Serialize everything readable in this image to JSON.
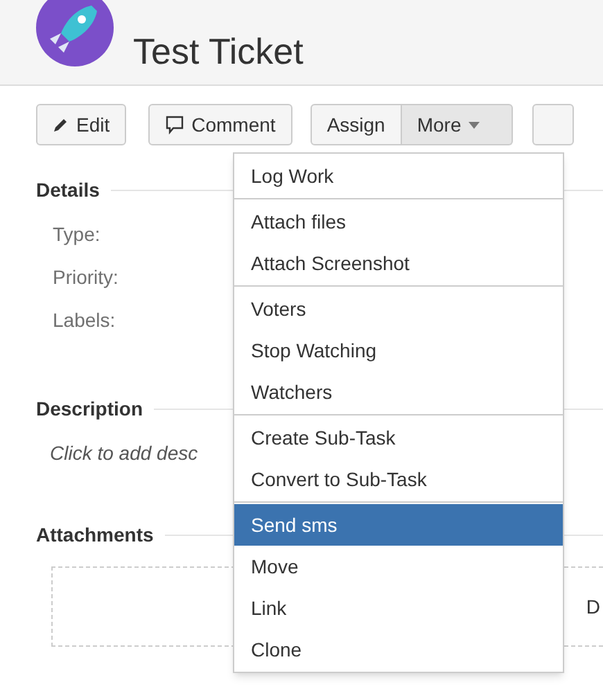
{
  "header": {
    "title": "Test Ticket"
  },
  "toolbar": [
    {
      "label": "Edit",
      "kind": "edit"
    },
    {
      "label": "Comment",
      "kind": "comment"
    },
    {
      "label": "Assign",
      "kind": "assign"
    },
    {
      "label": "More",
      "kind": "more"
    }
  ],
  "details": {
    "heading": "Details",
    "fields": [
      "Type:",
      "Priority:",
      "Labels:"
    ]
  },
  "description": {
    "heading": "Description",
    "placeholder": "Click to add desc"
  },
  "attachments": {
    "heading": "Attachments",
    "drop_text": "D"
  },
  "more_menu": [
    [
      {
        "label": "Log Work",
        "selected": false
      }
    ],
    [
      {
        "label": "Attach files",
        "selected": false
      },
      {
        "label": "Attach Screenshot",
        "selected": false
      }
    ],
    [
      {
        "label": "Voters",
        "selected": false
      },
      {
        "label": "Stop Watching",
        "selected": false
      },
      {
        "label": "Watchers",
        "selected": false
      }
    ],
    [
      {
        "label": "Create Sub-Task",
        "selected": false
      },
      {
        "label": "Convert to Sub-Task",
        "selected": false
      }
    ],
    [
      {
        "label": "Send sms",
        "selected": true
      },
      {
        "label": "Move",
        "selected": false
      },
      {
        "label": "Link",
        "selected": false
      },
      {
        "label": "Clone",
        "selected": false
      }
    ]
  ]
}
